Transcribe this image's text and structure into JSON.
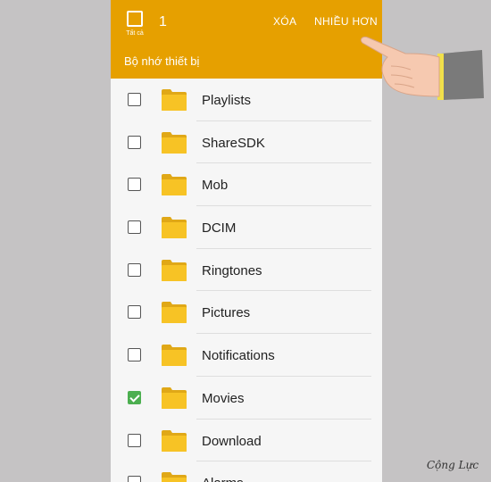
{
  "header": {
    "select_all_label": "Tất cả",
    "selected_count": "1",
    "delete_label": "XÓA",
    "more_label": "NHIỀU HƠN",
    "storage_label": "Bộ nhớ thiết bị"
  },
  "folders": [
    {
      "name": "Playlists",
      "checked": false
    },
    {
      "name": "ShareSDK",
      "checked": false
    },
    {
      "name": "Mob",
      "checked": false
    },
    {
      "name": "DCIM",
      "checked": false
    },
    {
      "name": "Ringtones",
      "checked": false
    },
    {
      "name": "Pictures",
      "checked": false
    },
    {
      "name": "Notifications",
      "checked": false
    },
    {
      "name": "Movies",
      "checked": true
    },
    {
      "name": "Download",
      "checked": false
    },
    {
      "name": "Alarms",
      "checked": false
    }
  ],
  "watermark": "Cộng Lực",
  "colors": {
    "header": "#e6a000",
    "check": "#4caf50",
    "folder": "#f7c325",
    "background": "#c5c3c4"
  }
}
